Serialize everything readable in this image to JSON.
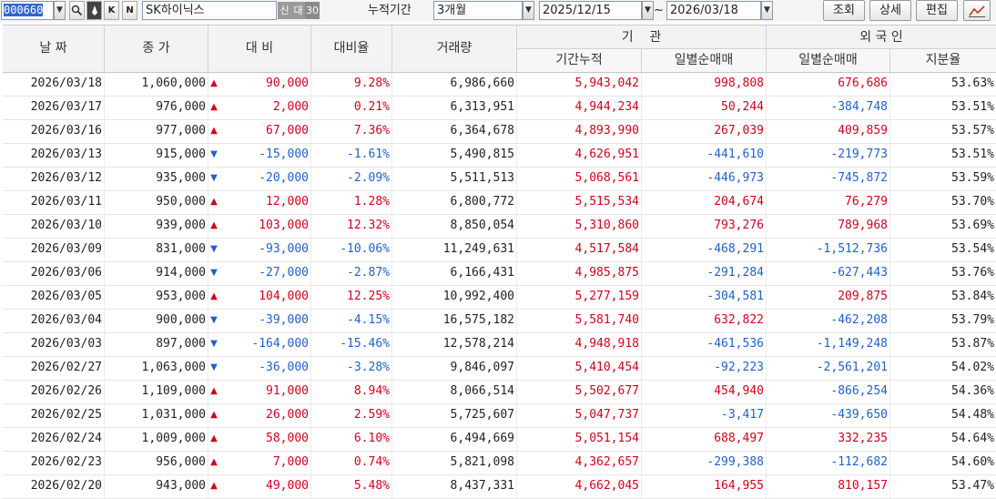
{
  "toolbar": {
    "code": "000660",
    "name": "SK하이닉스",
    "tag_new": "신",
    "tag_loan": "대",
    "tag_30": "30",
    "period_label": "누적기간",
    "period_value": "3개월",
    "date_from": "2025/12/15",
    "tilde": "~",
    "date_to": "2026/03/18",
    "btn_query": "조회",
    "btn_detail": "상세",
    "btn_edit": "편집",
    "btn_k": "K",
    "btn_n": "N"
  },
  "headers": {
    "date": "날 짜",
    "close": "종 가",
    "change": "대 비",
    "rate": "대비율",
    "volume": "거래량",
    "institution": "기    관",
    "inst_cumulative": "기간누적",
    "inst_daily": "일별순매매",
    "foreign": "외 국 인",
    "foreign_daily": "일별순매매",
    "foreign_ratio": "지분율"
  },
  "colors": {
    "up": "#d0021b",
    "down": "#1e62c8"
  },
  "rows": [
    {
      "date": "2026/03/18",
      "close": "1,060,000",
      "dir": "up",
      "change": "90,000",
      "rate": "9.28%",
      "volume": "6,986,660",
      "inst_cum": "5,943,042",
      "inst_daily": "998,808",
      "for_daily": "676,686",
      "for_ratio": "53.63%"
    },
    {
      "date": "2026/03/17",
      "close": "976,000",
      "dir": "up",
      "change": "2,000",
      "rate": "0.21%",
      "volume": "6,313,951",
      "inst_cum": "4,944,234",
      "inst_daily": "50,244",
      "for_daily": "-384,748",
      "for_ratio": "53.51%"
    },
    {
      "date": "2026/03/16",
      "close": "977,000",
      "dir": "up",
      "change": "67,000",
      "rate": "7.36%",
      "volume": "6,364,678",
      "inst_cum": "4,893,990",
      "inst_daily": "267,039",
      "for_daily": "409,859",
      "for_ratio": "53.57%"
    },
    {
      "date": "2026/03/13",
      "close": "915,000",
      "dir": "dn",
      "change": "-15,000",
      "rate": "-1.61%",
      "volume": "5,490,815",
      "inst_cum": "4,626,951",
      "inst_daily": "-441,610",
      "for_daily": "-219,773",
      "for_ratio": "53.51%"
    },
    {
      "date": "2026/03/12",
      "close": "935,000",
      "dir": "dn",
      "change": "-20,000",
      "rate": "-2.09%",
      "volume": "5,511,513",
      "inst_cum": "5,068,561",
      "inst_daily": "-446,973",
      "for_daily": "-745,872",
      "for_ratio": "53.59%"
    },
    {
      "date": "2026/03/11",
      "close": "950,000",
      "dir": "up",
      "change": "12,000",
      "rate": "1.28%",
      "volume": "6,800,772",
      "inst_cum": "5,515,534",
      "inst_daily": "204,674",
      "for_daily": "76,279",
      "for_ratio": "53.70%"
    },
    {
      "date": "2026/03/10",
      "close": "939,000",
      "dir": "up",
      "change": "103,000",
      "rate": "12.32%",
      "volume": "8,850,054",
      "inst_cum": "5,310,860",
      "inst_daily": "793,276",
      "for_daily": "789,968",
      "for_ratio": "53.69%"
    },
    {
      "date": "2026/03/09",
      "close": "831,000",
      "dir": "dn",
      "change": "-93,000",
      "rate": "-10.06%",
      "volume": "11,249,631",
      "inst_cum": "4,517,584",
      "inst_daily": "-468,291",
      "for_daily": "-1,512,736",
      "for_ratio": "53.54%"
    },
    {
      "date": "2026/03/06",
      "close": "914,000",
      "dir": "dn",
      "change": "-27,000",
      "rate": "-2.87%",
      "volume": "6,166,431",
      "inst_cum": "4,985,875",
      "inst_daily": "-291,284",
      "for_daily": "-627,443",
      "for_ratio": "53.76%"
    },
    {
      "date": "2026/03/05",
      "close": "953,000",
      "dir": "up",
      "change": "104,000",
      "rate": "12.25%",
      "volume": "10,992,400",
      "inst_cum": "5,277,159",
      "inst_daily": "-304,581",
      "for_daily": "209,875",
      "for_ratio": "53.84%"
    },
    {
      "date": "2026/03/04",
      "close": "900,000",
      "dir": "dn",
      "change": "-39,000",
      "rate": "-4.15%",
      "volume": "16,575,182",
      "inst_cum": "5,581,740",
      "inst_daily": "632,822",
      "for_daily": "-462,208",
      "for_ratio": "53.79%"
    },
    {
      "date": "2026/03/03",
      "close": "897,000",
      "dir": "dn",
      "change": "-164,000",
      "rate": "-15.46%",
      "volume": "12,578,214",
      "inst_cum": "4,948,918",
      "inst_daily": "-461,536",
      "for_daily": "-1,149,248",
      "for_ratio": "53.87%"
    },
    {
      "date": "2026/02/27",
      "close": "1,063,000",
      "dir": "dn",
      "change": "-36,000",
      "rate": "-3.28%",
      "volume": "9,846,097",
      "inst_cum": "5,410,454",
      "inst_daily": "-92,223",
      "for_daily": "-2,561,201",
      "for_ratio": "54.02%"
    },
    {
      "date": "2026/02/26",
      "close": "1,109,000",
      "dir": "up",
      "change": "91,000",
      "rate": "8.94%",
      "volume": "8,066,514",
      "inst_cum": "5,502,677",
      "inst_daily": "454,940",
      "for_daily": "-866,254",
      "for_ratio": "54.36%"
    },
    {
      "date": "2026/02/25",
      "close": "1,031,000",
      "dir": "up",
      "change": "26,000",
      "rate": "2.59%",
      "volume": "5,725,607",
      "inst_cum": "5,047,737",
      "inst_daily": "-3,417",
      "for_daily": "-439,650",
      "for_ratio": "54.48%"
    },
    {
      "date": "2026/02/24",
      "close": "1,009,000",
      "dir": "up",
      "change": "58,000",
      "rate": "6.10%",
      "volume": "6,494,669",
      "inst_cum": "5,051,154",
      "inst_daily": "688,497",
      "for_daily": "332,235",
      "for_ratio": "54.64%"
    },
    {
      "date": "2026/02/23",
      "close": "956,000",
      "dir": "up",
      "change": "7,000",
      "rate": "0.74%",
      "volume": "5,821,098",
      "inst_cum": "4,362,657",
      "inst_daily": "-299,388",
      "for_daily": "-112,682",
      "for_ratio": "54.60%"
    },
    {
      "date": "2026/02/20",
      "close": "943,000",
      "dir": "up",
      "change": "49,000",
      "rate": "5.48%",
      "volume": "8,437,331",
      "inst_cum": "4,662,045",
      "inst_daily": "164,955",
      "for_daily": "810,157",
      "for_ratio": "53.47%"
    }
  ]
}
